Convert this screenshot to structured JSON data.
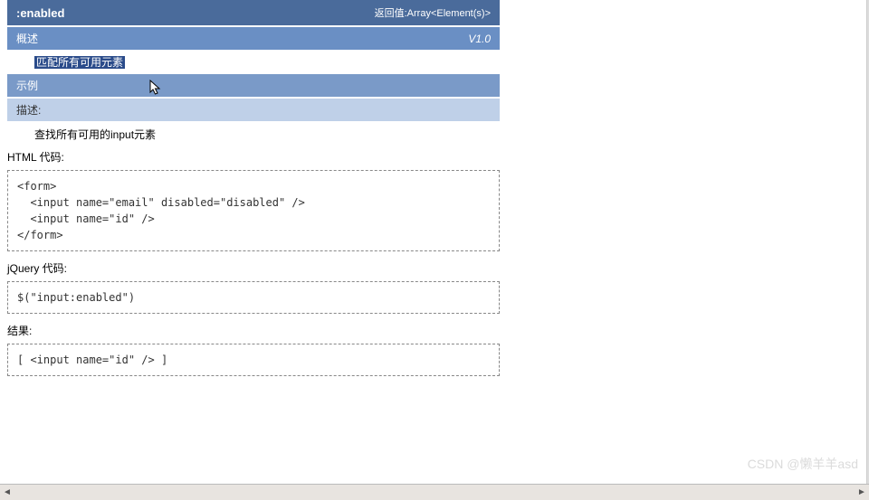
{
  "header": {
    "title": ":enabled",
    "return_label": "返回值:Array<Element(s)>"
  },
  "subheader": {
    "label": "概述",
    "version": "V1.0"
  },
  "highlight": "匹配所有可用元素",
  "example_label": "示例",
  "desc_label": "描述:",
  "desc_text": "查找所有可用的input元素",
  "html_label": "HTML 代码:",
  "html_code": "<form>\n  <input name=\"email\" disabled=\"disabled\" />\n  <input name=\"id\" />\n</form>",
  "jquery_label": "jQuery 代码:",
  "jquery_code": "$(\"input:enabled\")",
  "result_label": "结果:",
  "result_code": "[ <input name=\"id\" /> ]",
  "watermark": "CSDN @懒羊羊asd"
}
